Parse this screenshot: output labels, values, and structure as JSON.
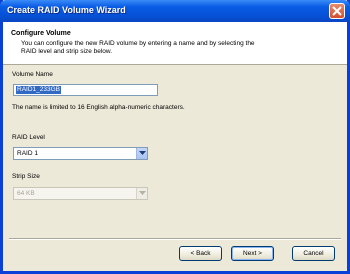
{
  "window": {
    "title": "Create RAID Volume Wizard"
  },
  "header": {
    "title": "Configure Volume",
    "description_line1": "You can configure the new RAID volume by entering a name and by selecting the",
    "description_line2": "RAID level and strip size below."
  },
  "form": {
    "volume_name": {
      "label": "Volume Name",
      "value": "RAID1_233GB"
    },
    "name_hint": "The name is limited to 16 English alpha-numeric characters.",
    "raid_level": {
      "label": "RAID Level",
      "selected": "RAID 1"
    },
    "strip_size": {
      "label": "Strip Size",
      "selected": "64 KB",
      "disabled": true
    }
  },
  "buttons": {
    "back": "< Back",
    "next": "Next >",
    "cancel": "Cancel"
  },
  "colors": {
    "titlebar": "#0a5ce5",
    "selection": "#316ac5",
    "dialog_bg": "#ece9d8"
  }
}
